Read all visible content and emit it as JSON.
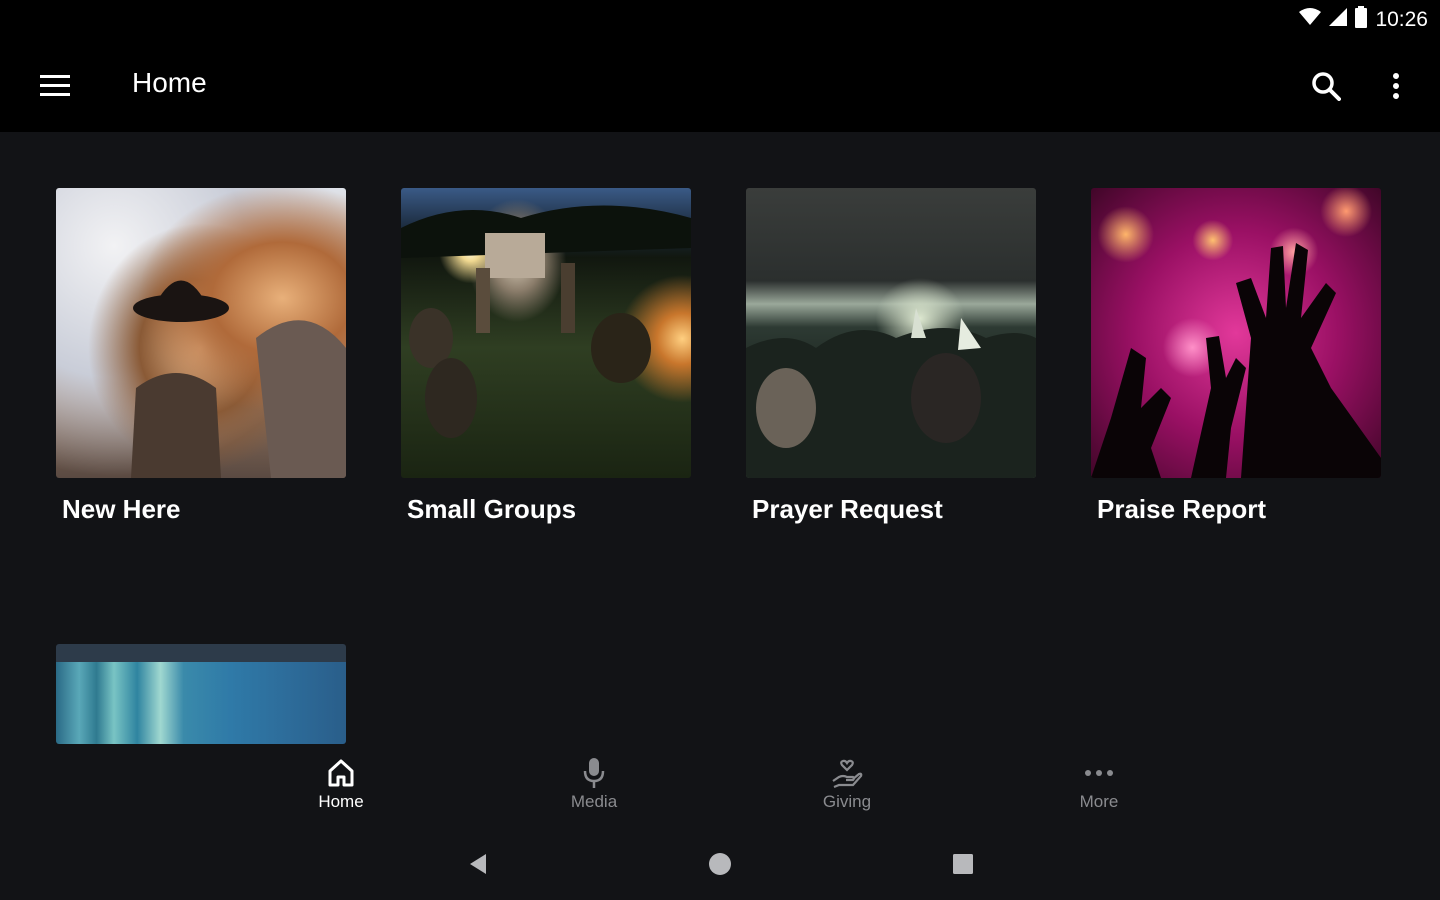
{
  "status_bar": {
    "time": "10:26"
  },
  "app_bar": {
    "title": "Home"
  },
  "tiles": [
    {
      "label": "New Here"
    },
    {
      "label": "Small Groups"
    },
    {
      "label": "Prayer Request"
    },
    {
      "label": "Praise Report"
    },
    {
      "label": ""
    }
  ],
  "bottom_nav": {
    "active": "Home",
    "items": [
      {
        "label": "Home",
        "icon": "home-icon"
      },
      {
        "label": "Media",
        "icon": "microphone-icon"
      },
      {
        "label": "Giving",
        "icon": "giving-hand-icon"
      },
      {
        "label": "More",
        "icon": "more-horizontal-icon"
      }
    ]
  },
  "colors": {
    "background": "#121316",
    "app_bar": "#000000",
    "nav_active": "#ffffff",
    "nav_inactive": "#8a8b8f"
  }
}
